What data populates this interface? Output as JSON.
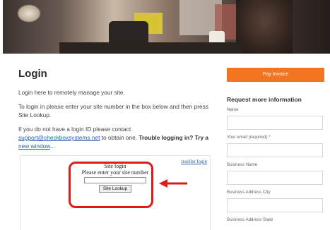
{
  "hero": {
    "alt": ""
  },
  "login": {
    "title": "Login",
    "intro": "Login here to remotely manage your site.",
    "instructions": "To login in please enter your site number in the box below and then press Site Lookup.",
    "no_id_prefix": "If you do not have a login ID please contact",
    "support_email": "support@checkboxsystems.net",
    "no_id_mid": "to obtain one.",
    "trouble_text": "Trouble logging in? Try a",
    "new_window_link": "new window",
    "new_window_suffix": "...",
    "reseller_link": "reseller login",
    "box_title": "Site login",
    "box_prompt": "Please enter your site number",
    "site_number_value": "",
    "lookup_button": "Site Lookup"
  },
  "sidebar": {
    "pay_invoice_button": "Pay Invoice",
    "form_title": "Request more information",
    "fields": [
      {
        "label": "Name",
        "required_mark": "",
        "value": ""
      },
      {
        "label": "Your email (required)",
        "required_mark": "*",
        "value": ""
      },
      {
        "label": "Business Name",
        "required_mark": "",
        "value": ""
      },
      {
        "label": "Business Address City",
        "required_mark": "",
        "value": ""
      },
      {
        "label": "Business Address State",
        "required_mark": "",
        "value": ""
      }
    ]
  },
  "colors": {
    "accent_orange": "#f47521",
    "link_blue": "#2a5ea8",
    "highlight_red": "#e0191b"
  },
  "icons": {
    "annotation": "right-pointing-arrow-icon"
  }
}
